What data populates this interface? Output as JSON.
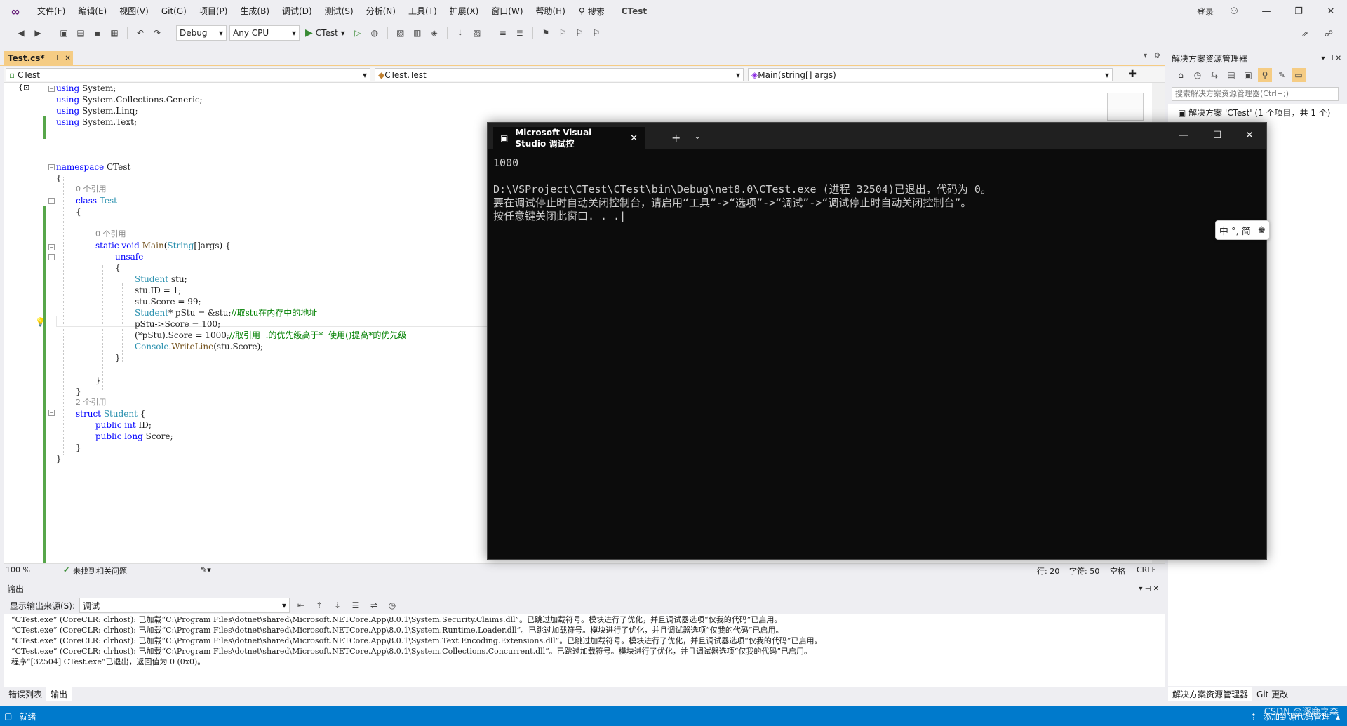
{
  "window": {
    "menu": [
      "文件(F)",
      "编辑(E)",
      "视图(V)",
      "Git(G)",
      "项目(P)",
      "生成(B)",
      "调试(D)",
      "测试(S)",
      "分析(N)",
      "工具(T)",
      "扩展(X)",
      "窗口(W)",
      "帮助(H)"
    ],
    "search": "搜索",
    "app_title": "CTest",
    "login": "登录"
  },
  "toolbar": {
    "config": "Debug",
    "platform": "Any CPU",
    "run_label": "CTest"
  },
  "editor": {
    "tab_label": "Test.cs*",
    "nav_project": "CTest",
    "nav_class": "CTest.Test",
    "nav_member": "Main(string[] args)",
    "lines": {
      "u1_kw": "using",
      "u1_ns": " System;",
      "u2_kw": "using",
      "u2_ns": " System.Collections.Generic;",
      "u3_kw": "using",
      "u3_ns": " System.Linq;",
      "u4_kw": "using",
      "u4_ns": " System.Text;",
      "ns_kw": "namespace",
      "ns_name": " CTest",
      "brace_open": "{",
      "ref0": "0 个引用",
      "class_kw": "class",
      "class_name": " Test",
      "ref1": "0 个引用",
      "main_kw": "static void",
      "main_name": " Main",
      "main_p1": "(",
      "main_ty": "String",
      "main_p2": "[]args) {",
      "unsafe_kw": "unsafe",
      "b1": "{",
      "l1_ty": "Student",
      "l1_rest": " stu;",
      "l2": "stu.ID = 1;",
      "l3": "stu.Score = 99;",
      "l4_ty": "Student",
      "l4_rest": "* pStu = &stu;",
      "l4_cm": "//取stu在内存中的地址",
      "l5": "pStu->Score = 100;",
      "l6_rest": "(*pStu).Score = 1000;",
      "l6_cm": "//取引用  .的优先级高于*  使用()提高*的优先级",
      "l7_ty": "Console",
      "l7_dot": ".",
      "l7_m": "WriteLine",
      "l7_rest": "(stu.Score);",
      "b2": "}",
      "b3": "}",
      "b4": "}",
      "ref2": "2 个引用",
      "struct_kw": "struct",
      "struct_name": " Student",
      "struct_rest": " {",
      "f1_kw": "public int",
      "f1_rest": " ID;",
      "f2_kw": "public long",
      "f2_rest": " Score;",
      "b5": "}",
      "b6": "}"
    },
    "zoom": "100 %",
    "issues": "未找到相关问题",
    "row": "行: 20",
    "col": "字符: 50",
    "ws": "空格",
    "eol": "CRLF"
  },
  "output": {
    "title": "输出",
    "source_label": "显示输出来源(S):",
    "source_value": "调试",
    "lines": [
      "“CTest.exe” (CoreCLR: clrhost): 已加载“C:\\Program Files\\dotnet\\shared\\Microsoft.NETCore.App\\8.0.1\\System.Security.Claims.dll”。已跳过加载符号。模块进行了优化，并且调试器选项“仅我的代码”已启用。",
      "“CTest.exe” (CoreCLR: clrhost): 已加载“C:\\Program Files\\dotnet\\shared\\Microsoft.NETCore.App\\8.0.1\\System.Runtime.Loader.dll”。已跳过加载符号。模块进行了优化，并且调试器选项“仅我的代码”已启用。",
      "“CTest.exe” (CoreCLR: clrhost): 已加载“C:\\Program Files\\dotnet\\shared\\Microsoft.NETCore.App\\8.0.1\\System.Text.Encoding.Extensions.dll”。已跳过加载符号。模块进行了优化，并且调试器选项“仅我的代码”已启用。",
      "“CTest.exe” (CoreCLR: clrhost): 已加载“C:\\Program Files\\dotnet\\shared\\Microsoft.NETCore.App\\8.0.1\\System.Collections.Concurrent.dll”。已跳过加载符号。模块进行了优化，并且调试器选项“仅我的代码”已启用。",
      "程序“[32504] CTest.exe”已退出，返回值为 0 (0x0)。"
    ],
    "tab_errors": "错误列表",
    "tab_output": "输出"
  },
  "solution": {
    "title": "解决方案资源管理器",
    "search_placeholder": "搜索解决方案资源管理器(Ctrl+;)",
    "root": "解决方案 'CTest' (1 个项目，共 1 个)",
    "tab_se": "解决方案资源管理器",
    "tab_git": "Git 更改"
  },
  "statusbar": {
    "ready": "就绪",
    "add_source": "添加到源代码管理",
    "watermark": "CSDN @逐鹿之森"
  },
  "console": {
    "tab_title": "Microsoft Visual Studio 调试控",
    "output": "1000\n\nD:\\VSProject\\CTest\\CTest\\bin\\Debug\\net8.0\\CTest.exe (进程 32504)已退出，代码为 0。\n要在调试停止时自动关闭控制台，请启用“工具”->“选项”->“调试”->“调试停止时自动关闭控制台”。\n按任意键关闭此窗口. . .|"
  },
  "ime": "中 °, 简"
}
